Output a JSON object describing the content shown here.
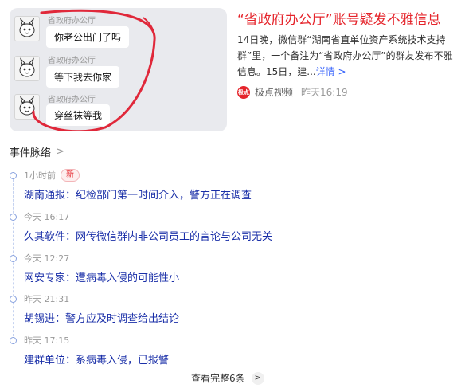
{
  "card": {
    "headline": "“省政府办公厅”账号疑发不雅信息",
    "summary": "14日晚，微信群“湖南省直单位资产系统技术支持群”里，一个备注为“省政府办公厅”的群友发布不雅信息。15日，建...",
    "more_label": "详情 >",
    "source_name": "极点视频",
    "source_time": "昨天16:19",
    "source_logo_text": "极点",
    "thumbnail": {
      "messages": [
        {
          "sender": "省政府办公厅",
          "text": "你老公出门了吗"
        },
        {
          "sender": "省政府办公厅",
          "text": "等下我去你家"
        },
        {
          "sender": "省政府办公厅",
          "text": "穿丝袜等我"
        }
      ],
      "ring_color": "#e0283a"
    }
  },
  "timeline": {
    "title": "事件脉络",
    "title_chevron": ">",
    "items": [
      {
        "time": "1小时前",
        "badge": "新",
        "title": "湖南通报：纪检部门第一时间介入，警方正在调查"
      },
      {
        "time": "今天 16:17",
        "title": "久其软件：网传微信群内非公司员工的言论与公司无关"
      },
      {
        "time": "今天 12:27",
        "title": "网安专家：遭病毒入侵的可能性小"
      },
      {
        "time": "昨天 21:31",
        "title": "胡锡进：警方应及时调查给出结论"
      },
      {
        "time": "昨天 17:15",
        "title": "建群单位：系病毒入侵，已报警"
      }
    ],
    "view_all": "查看完整6条",
    "view_all_chevron": ">"
  },
  "colors": {
    "headline": "#e5242b",
    "link": "#1a2fa8",
    "more": "#315efb",
    "badge": "#e5242b"
  }
}
